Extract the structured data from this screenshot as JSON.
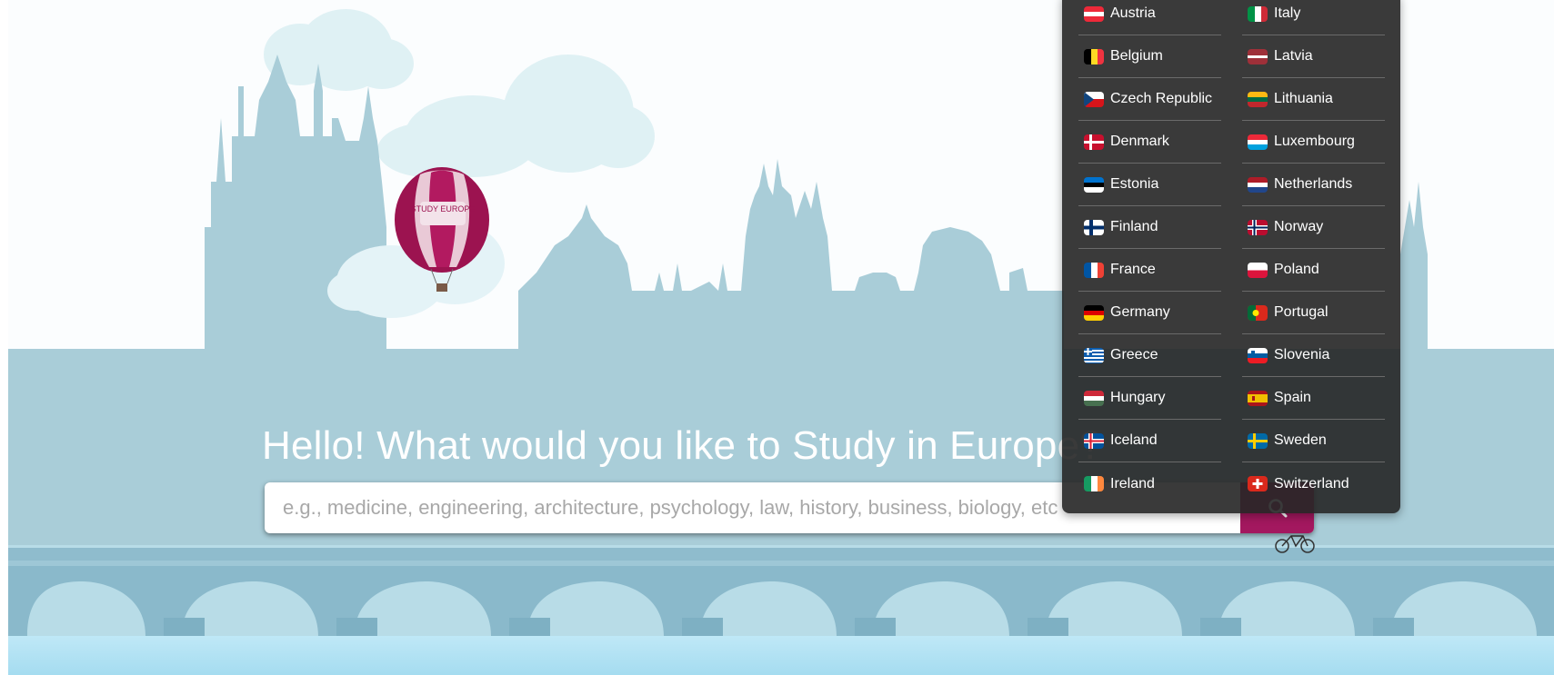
{
  "hero": {
    "heading": "Hello! What would you like to Study in Europe?",
    "balloon_text": "STUDY EUROPE",
    "colors": {
      "sky": "#fbfdfe",
      "silhouette": "#a9cdd8",
      "bridge": "#8fc0d2",
      "water": "#bfe8f7"
    }
  },
  "search": {
    "placeholder": "e.g., medicine, engineering, architecture, psychology, law, history, business, biology, etc",
    "value": "",
    "button_icon": "search-icon",
    "button_color": "#a3185f"
  },
  "country_menu": {
    "left": [
      {
        "name": "Austria",
        "flag": "austria-flag-icon"
      },
      {
        "name": "Belgium",
        "flag": "belgium-flag-icon"
      },
      {
        "name": "Czech Republic",
        "flag": "czech-flag-icon"
      },
      {
        "name": "Denmark",
        "flag": "denmark-flag-icon"
      },
      {
        "name": "Estonia",
        "flag": "estonia-flag-icon"
      },
      {
        "name": "Finland",
        "flag": "finland-flag-icon"
      },
      {
        "name": "France",
        "flag": "france-flag-icon"
      },
      {
        "name": "Germany",
        "flag": "germany-flag-icon"
      },
      {
        "name": "Greece",
        "flag": "greece-flag-icon"
      },
      {
        "name": "Hungary",
        "flag": "hungary-flag-icon"
      },
      {
        "name": "Iceland",
        "flag": "iceland-flag-icon"
      },
      {
        "name": "Ireland",
        "flag": "ireland-flag-icon"
      }
    ],
    "right": [
      {
        "name": "Italy",
        "flag": "italy-flag-icon"
      },
      {
        "name": "Latvia",
        "flag": "latvia-flag-icon"
      },
      {
        "name": "Lithuania",
        "flag": "lithuania-flag-icon"
      },
      {
        "name": "Luxembourg",
        "flag": "luxembourg-flag-icon"
      },
      {
        "name": "Netherlands",
        "flag": "netherlands-flag-icon"
      },
      {
        "name": "Norway",
        "flag": "norway-flag-icon"
      },
      {
        "name": "Poland",
        "flag": "poland-flag-icon"
      },
      {
        "name": "Portugal",
        "flag": "portugal-flag-icon"
      },
      {
        "name": "Slovenia",
        "flag": "slovenia-flag-icon"
      },
      {
        "name": "Spain",
        "flag": "spain-flag-icon"
      },
      {
        "name": "Sweden",
        "flag": "sweden-flag-icon"
      },
      {
        "name": "Switzerland",
        "flag": "switzerland-flag-icon"
      }
    ]
  }
}
